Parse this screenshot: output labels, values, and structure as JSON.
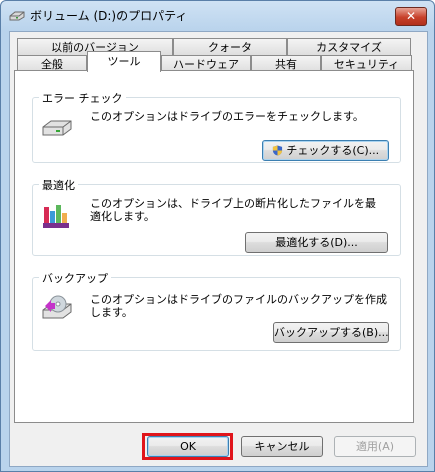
{
  "window": {
    "title": "ボリューム (D:)のプロパティ",
    "close_label": "✕"
  },
  "tabs": {
    "row1": [
      "以前のバージョン",
      "クォータ",
      "カスタマイズ"
    ],
    "row2": [
      "全般",
      "ツール",
      "ハードウェア",
      "共有",
      "セキュリティ"
    ],
    "active": "ツール"
  },
  "groups": {
    "error_check": {
      "title": "エラー チェック",
      "description": "このオプションはドライブのエラーをチェックします。",
      "button": "チェックする(C)..."
    },
    "defrag": {
      "title": "最適化",
      "description": "このオプションは、ドライブ上の断片化したファイルを最適化します。",
      "button": "最適化する(D)..."
    },
    "backup": {
      "title": "バックアップ",
      "description": "このオプションはドライブのファイルのバックアップを作成します。",
      "button": "バックアップする(B)..."
    }
  },
  "footer": {
    "ok": "OK",
    "cancel": "キャンセル",
    "apply": "適用(A)"
  },
  "colors": {
    "highlight": "#e0151b",
    "accent": "#3c7fb1"
  }
}
